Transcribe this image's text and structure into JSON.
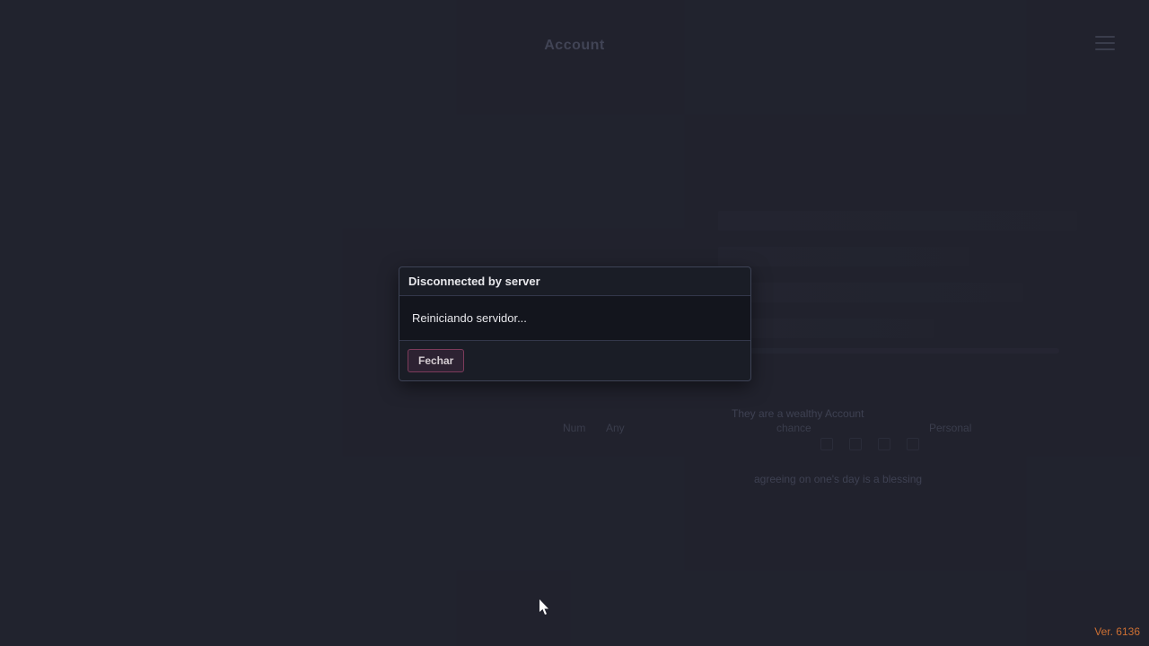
{
  "header": {
    "title": "Account"
  },
  "modal": {
    "title": "Disconnected by server",
    "message": "Reiniciando servidor...",
    "close_label": "Fechar"
  },
  "footer": {
    "version": "Ver. 6136"
  },
  "background": {
    "text1": "They are a wealthy Account",
    "text2": "agreeing on one's day is a blessing",
    "label1": "Num",
    "label2": "Any",
    "label3": "chance",
    "label4": "Personal"
  }
}
